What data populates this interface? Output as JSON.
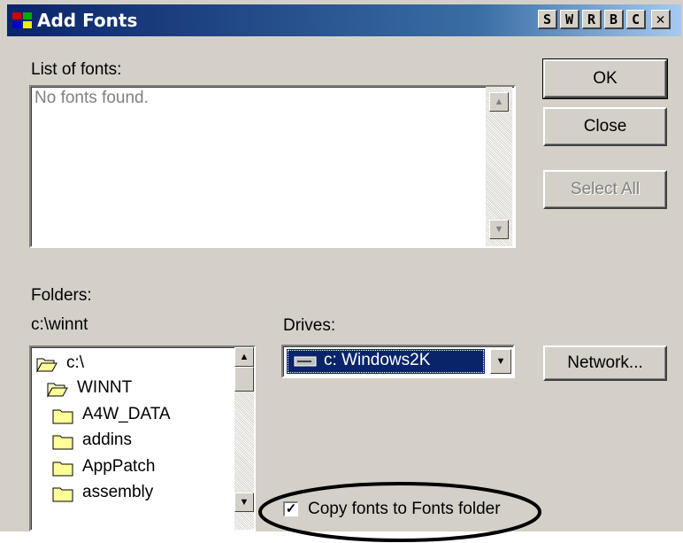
{
  "window": {
    "title": "Add Fonts",
    "title_buttons": [
      "S",
      "W",
      "R",
      "B",
      "C"
    ],
    "close_glyph": "✕"
  },
  "fonts": {
    "label": "List of fonts:",
    "empty_text": "No fonts found."
  },
  "buttons": {
    "ok": "OK",
    "close": "Close",
    "select_all": "Select All",
    "network": "Network..."
  },
  "folders": {
    "label": "Folders:",
    "current_path": "c:\\winnt",
    "items": [
      {
        "name": "c:\\",
        "icon": "open-folder-icon"
      },
      {
        "name": "WINNT",
        "icon": "open-folder-icon"
      },
      {
        "name": "A4W_DATA",
        "icon": "folder-icon"
      },
      {
        "name": "addins",
        "icon": "folder-icon"
      },
      {
        "name": "AppPatch",
        "icon": "folder-icon"
      },
      {
        "name": "assembly",
        "icon": "folder-icon"
      }
    ]
  },
  "drives": {
    "label": "Drives:",
    "selected": "c: Windows2K"
  },
  "copy_option": {
    "label": "Copy fonts to Fonts folder",
    "checked": true
  },
  "colors": {
    "title_start": "#0a246a",
    "title_end": "#a6caf0",
    "face": "#d4d0c8",
    "selection": "#0a246a"
  }
}
